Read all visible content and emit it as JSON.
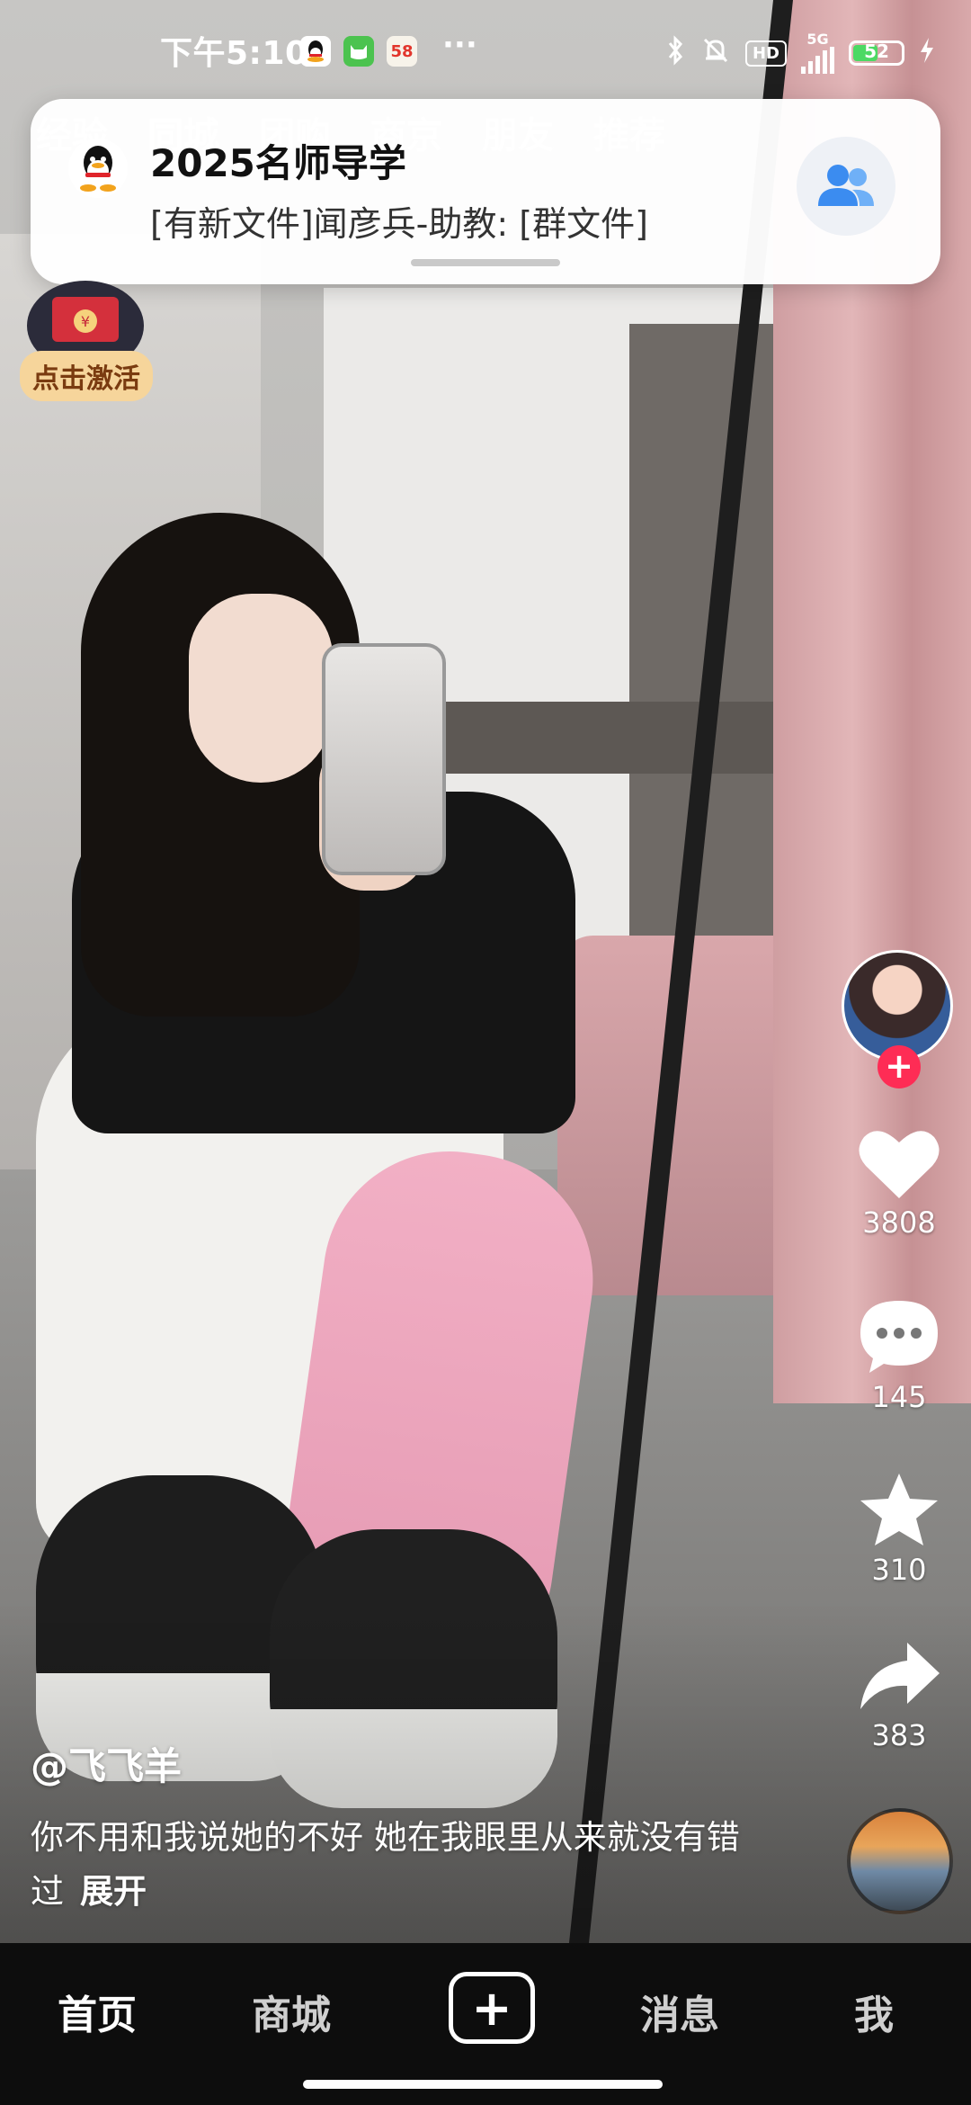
{
  "status_bar": {
    "time": "下午5:10",
    "app_58_label": "58",
    "dots": "···",
    "net_type": "5G",
    "hd_label": "HD",
    "battery_level": 52,
    "battery_text": "52"
  },
  "top_nav": {
    "tabs": [
      "经验",
      "同城",
      "团购",
      "商京",
      "朋友",
      "推荐"
    ]
  },
  "notification": {
    "title": "2025名师导学",
    "body": "[有新文件]闻彦兵-助教: [群文件]"
  },
  "activate_badge": {
    "label": "点击激活",
    "coin": "¥"
  },
  "rail": {
    "follow": "+",
    "likes": "3808",
    "comments": "145",
    "favorites": "310",
    "shares": "383"
  },
  "caption": {
    "author": "@飞飞羊",
    "text": "你不用和我说她的不好 她在我眼里从来就没有错过",
    "expand": "展开"
  },
  "bottom_nav": {
    "home": "首页",
    "mall": "商城",
    "add": "+",
    "messages": "消息",
    "me": "我"
  },
  "colors": {
    "accent_red": "#fe2c55",
    "battery_green": "#4cd964",
    "group_icon_blue": "#3b8cf0"
  }
}
